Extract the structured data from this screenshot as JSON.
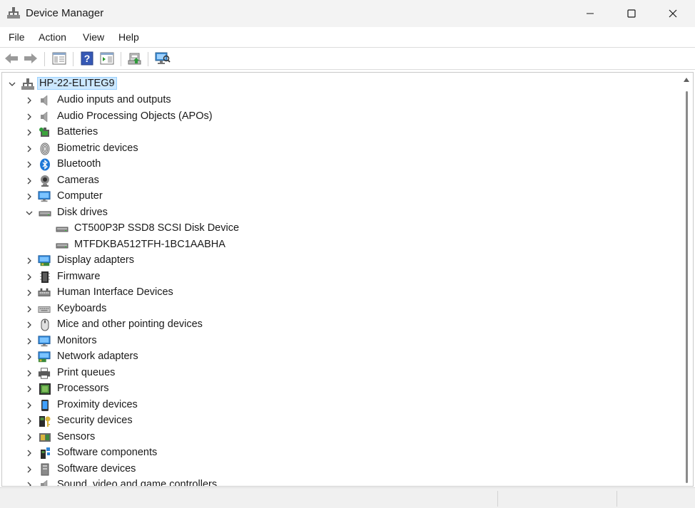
{
  "window": {
    "title": "Device Manager",
    "controls": [
      "minimize",
      "maximize",
      "close"
    ]
  },
  "menu": [
    "File",
    "Action",
    "View",
    "Help"
  ],
  "toolbar": {
    "buttons": [
      "back-icon",
      "forward-icon",
      "show-hide-console-tree-icon",
      "help-icon",
      "properties-icon",
      "update-driver-icon",
      "scan-hardware-icon"
    ]
  },
  "tree": {
    "root": "HP-22-ELITEG9",
    "categories": [
      {
        "label": "Audio inputs and outputs",
        "icon": "speaker-icon",
        "expanded": false
      },
      {
        "label": "Audio Processing Objects (APOs)",
        "icon": "speaker-icon",
        "expanded": false
      },
      {
        "label": "Batteries",
        "icon": "battery-icon",
        "expanded": false
      },
      {
        "label": "Biometric devices",
        "icon": "fingerprint-icon",
        "expanded": false
      },
      {
        "label": "Bluetooth",
        "icon": "bluetooth-icon",
        "expanded": false
      },
      {
        "label": "Cameras",
        "icon": "camera-icon",
        "expanded": false
      },
      {
        "label": "Computer",
        "icon": "computer-icon",
        "expanded": false
      },
      {
        "label": "Disk drives",
        "icon": "disk-drive-icon",
        "expanded": true,
        "children": [
          "CT500P3P SSD8 SCSI Disk Device",
          "MTFDKBA512TFH-1BC1AABHA"
        ]
      },
      {
        "label": "Display adapters",
        "icon": "display-adapter-icon",
        "expanded": false
      },
      {
        "label": "Firmware",
        "icon": "firmware-icon",
        "expanded": false
      },
      {
        "label": "Human Interface Devices",
        "icon": "hid-icon",
        "expanded": false
      },
      {
        "label": "Keyboards",
        "icon": "keyboard-icon",
        "expanded": false
      },
      {
        "label": "Mice and other pointing devices",
        "icon": "mouse-icon",
        "expanded": false
      },
      {
        "label": "Monitors",
        "icon": "monitor-icon",
        "expanded": false
      },
      {
        "label": "Network adapters",
        "icon": "network-adapter-icon",
        "expanded": false
      },
      {
        "label": "Print queues",
        "icon": "printer-icon",
        "expanded": false
      },
      {
        "label": "Processors",
        "icon": "processor-icon",
        "expanded": false
      },
      {
        "label": "Proximity devices",
        "icon": "proximity-icon",
        "expanded": false
      },
      {
        "label": "Security devices",
        "icon": "security-icon",
        "expanded": false
      },
      {
        "label": "Sensors",
        "icon": "sensor-icon",
        "expanded": false
      },
      {
        "label": "Software components",
        "icon": "software-component-icon",
        "expanded": false
      },
      {
        "label": "Software devices",
        "icon": "software-device-icon",
        "expanded": false
      },
      {
        "label": "Sound, video and game controllers",
        "icon": "speaker-icon",
        "expanded": false
      }
    ]
  },
  "colors": {
    "selection_bg": "#cce8ff",
    "selection_border": "#99d1ff",
    "accent_blue": "#1e78d7"
  }
}
